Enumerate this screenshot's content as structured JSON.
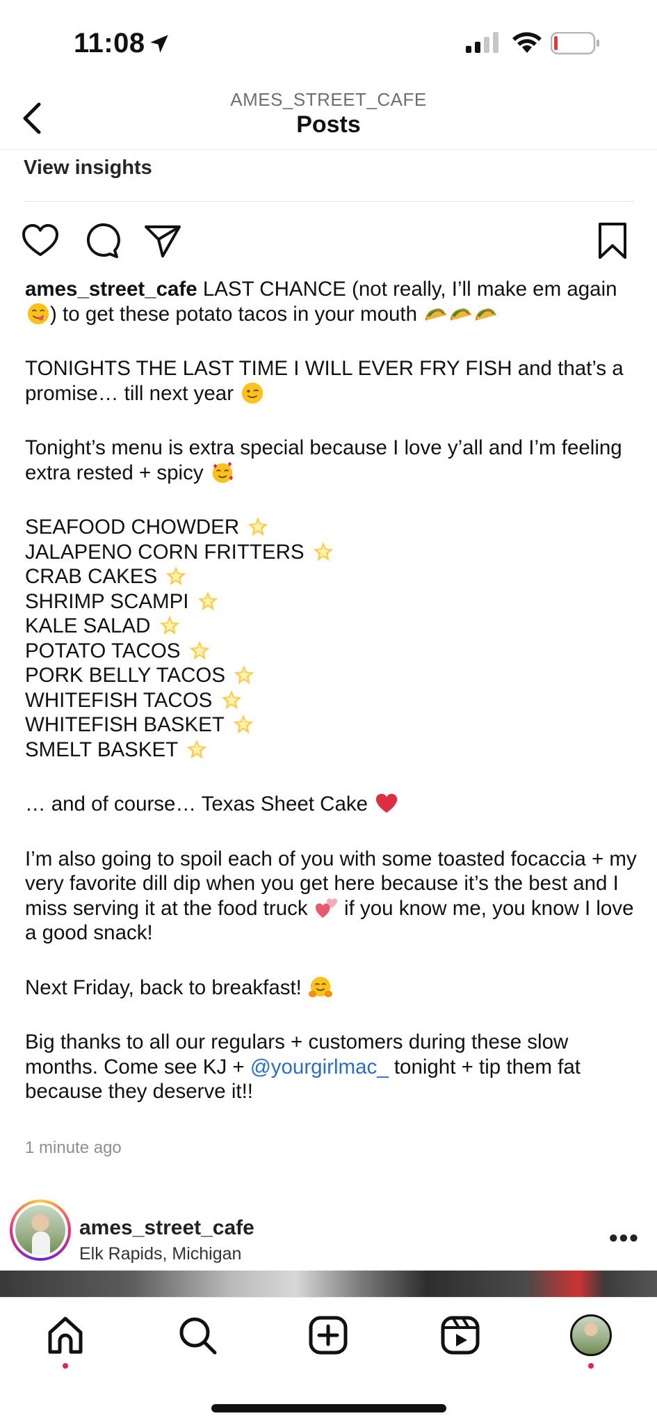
{
  "status_bar": {
    "time": "11:08"
  },
  "header": {
    "account": "AMES_STREET_CAFE",
    "title": "Posts"
  },
  "insights_label": "View insights",
  "caption": {
    "username": "ames_street_cafe",
    "p1a": " LAST CHANCE (not really, I’ll make em again ",
    "p1b": ") to get these potato tacos in your mouth ",
    "p2": "TONIGHTS THE LAST TIME I WILL EVER FRY FISH and that’s a promise… till next year ",
    "p3": "Tonight’s menu is extra special because I love y’all and I’m feeling extra rested + spicy ",
    "menu": [
      "SEAFOOD CHOWDER",
      "JALAPENO CORN FRITTERS",
      "CRAB CAKES",
      "SHRIMP SCAMPI",
      "KALE SALAD",
      "POTATO TACOS",
      "PORK BELLY TACOS",
      "WHITEFISH TACOS",
      "WHITEFISH BASKET",
      "SMELT BASKET"
    ],
    "p4": "… and of course… Texas Sheet Cake ",
    "p5a": "I’m also going to spoil each of you with some toasted focaccia + my very favorite dill dip when you get here because it’s the best and I miss serving it at the food truck ",
    "p5b": " if you know me, you know I love a good snack!",
    "p6": "Next Friday, back to breakfast! ",
    "p7a": "Big thanks to all our regulars + customers during these slow months. Come see KJ + ",
    "mention": "@yourgirlmac_",
    "p7b": " tonight + tip them fat because they deserve it!!"
  },
  "time_ago": "1 minute ago",
  "next_post": {
    "username": "ames_street_cafe",
    "location": "Elk Rapids, Michigan",
    "more": "•••"
  },
  "icons": {
    "emoji_yum": "yum-emoji-icon",
    "emoji_taco": "taco-emoji-icon",
    "emoji_wink": "wink-emoji-icon",
    "emoji_hearts": "smiling-hearts-emoji-icon",
    "emoji_star": "glowing-star-emoji-icon",
    "emoji_heart": "red-heart-emoji-icon",
    "emoji_two_hearts": "two-hearts-emoji-icon",
    "emoji_hug": "hugging-emoji-icon"
  }
}
